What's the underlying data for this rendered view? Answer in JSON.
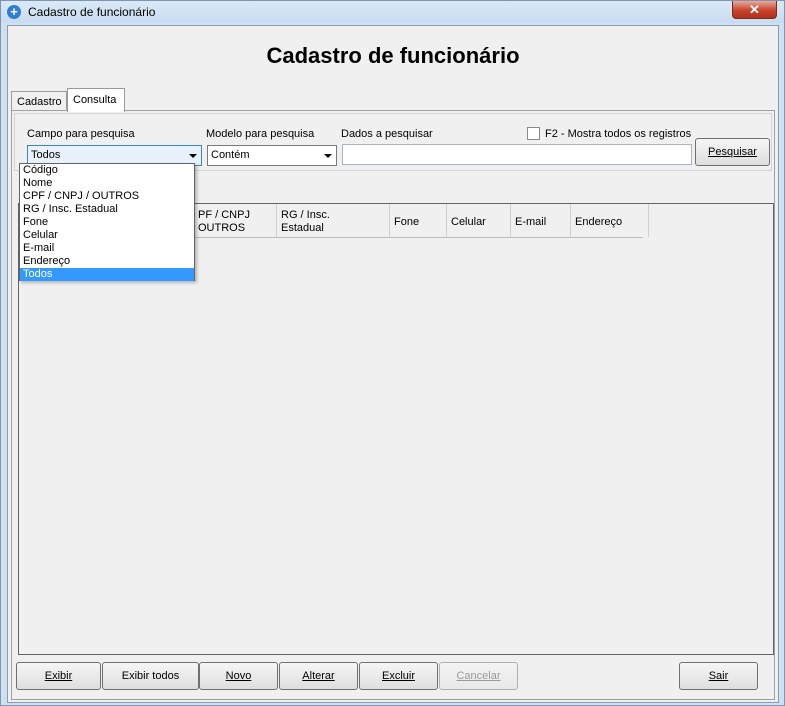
{
  "window": {
    "title": "Cadastro de funcionário",
    "close_label": "✕"
  },
  "heading": "Cadastro de funcionário",
  "tabs": [
    {
      "label": "Cadastro"
    },
    {
      "label": "Consulta"
    }
  ],
  "search": {
    "campo_label": "Campo para pesquisa",
    "campo_value": "Todos",
    "modelo_label": "Modelo para pesquisa",
    "modelo_value": "Contém",
    "dados_label": "Dados a pesquisar",
    "dados_value": "",
    "show_all_label": "F2 - Mostra todos os registros",
    "pesquisar_label": "Pesquisar"
  },
  "dropdown": {
    "options": [
      "Código",
      "Nome",
      "CPF / CNPJ / OUTROS",
      "RG / Insc. Estadual",
      "Fone",
      "Celular",
      "E-mail",
      "Endereço",
      "Todos"
    ],
    "selected": "Todos"
  },
  "grid": {
    "columns": [
      {
        "line1": "PF / CNPJ",
        "line2": "OUTROS"
      },
      {
        "line1": "RG / Insc.",
        "line2": "Estadual"
      },
      {
        "line1": "Fone",
        "line2": ""
      },
      {
        "line1": "Celular",
        "line2": ""
      },
      {
        "line1": "E-mail",
        "line2": ""
      },
      {
        "line1": "Endereço",
        "line2": ""
      }
    ],
    "rows": []
  },
  "buttons": {
    "exibir": "Exibir",
    "exibir_todos": "Exibir todos",
    "novo": "Novo",
    "alterar": "Alterar",
    "excluir": "Excluir",
    "cancelar": "Cancelar",
    "sair": "Sair"
  },
  "colors": {
    "selection": "#3399ff",
    "window_frame": "#cfe0f1",
    "close_button": "#c7432b"
  }
}
